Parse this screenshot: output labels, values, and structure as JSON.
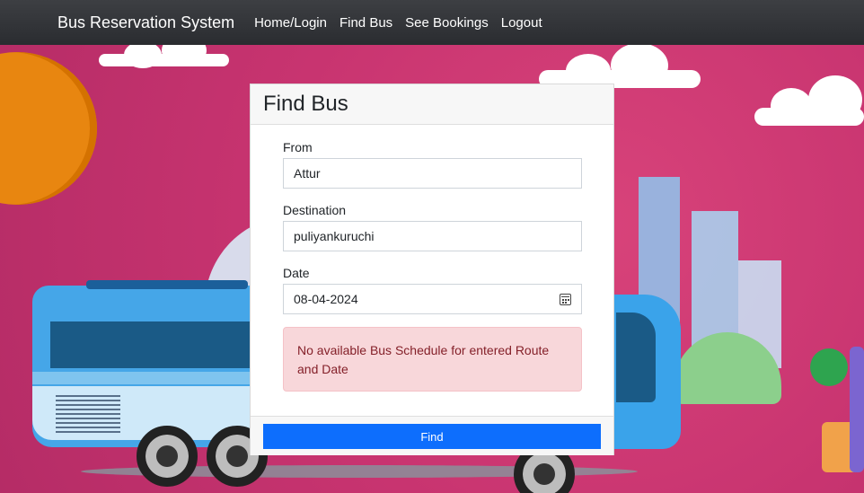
{
  "navbar": {
    "brand": "Bus Reservation System",
    "links": [
      "Home/Login",
      "Find Bus",
      "See Bookings",
      "Logout"
    ]
  },
  "card": {
    "title": "Find Bus",
    "from": {
      "label": "From",
      "value": "Attur"
    },
    "destination": {
      "label": "Destination",
      "value": "puliyankuruchi"
    },
    "date": {
      "label": "Date",
      "value": "08-04-2024"
    },
    "alert": "No available Bus Schedule for entered Route and Date",
    "button": "Find"
  },
  "icons": {
    "calendar": "calendar-icon"
  },
  "colors": {
    "navbar": "#2a2c30",
    "primary_button": "#0d6efd",
    "alert_background": "#f8d7da",
    "alert_text": "#842029"
  }
}
